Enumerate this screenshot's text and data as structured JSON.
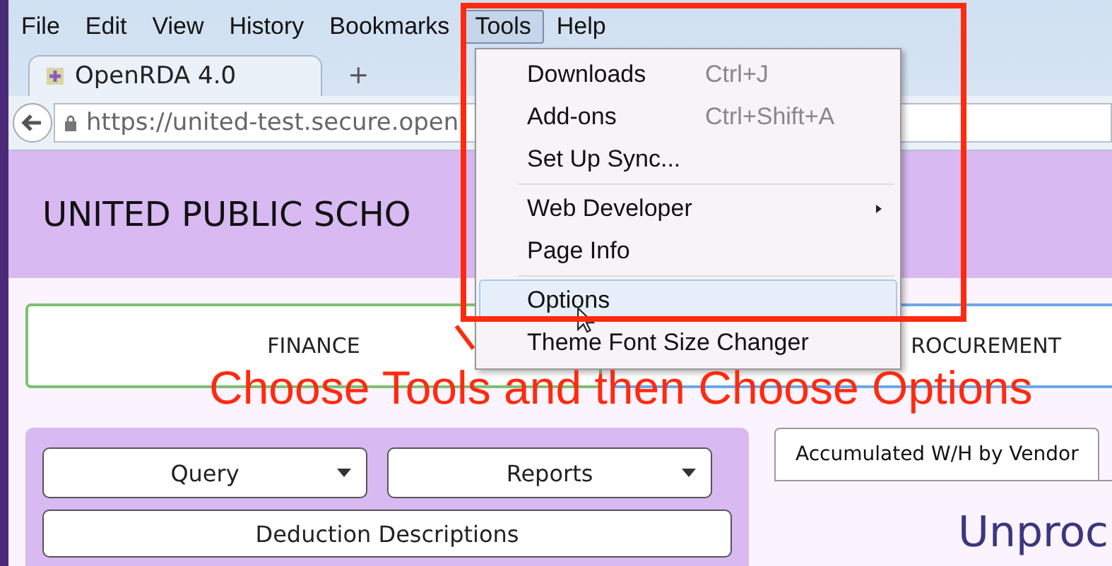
{
  "menu_bar": [
    {
      "label": "File",
      "selected": false
    },
    {
      "label": "Edit",
      "selected": false
    },
    {
      "label": "View",
      "selected": false
    },
    {
      "label": "History",
      "selected": false
    },
    {
      "label": "Bookmarks",
      "selected": false
    },
    {
      "label": "Tools",
      "selected": true
    },
    {
      "label": "Help",
      "selected": false
    }
  ],
  "tabs": [
    {
      "label": "OpenRDA 4.0",
      "selected": true
    }
  ],
  "new_tab": "+",
  "address_bar": {
    "value": "https://united-test.secure.open"
  },
  "header": {
    "title": "UNITED PUBLIC SCHO"
  },
  "modules": [
    {
      "label": "FINANCE",
      "color": "#7cc073"
    },
    {
      "label": "ROCUREMENT",
      "color": "#6aa9e6"
    }
  ],
  "panel_buttons": [
    {
      "label": "Query",
      "kind": "dropdown"
    },
    {
      "label": "Reports",
      "kind": "dropdown"
    },
    {
      "label": "Deduction Descriptions",
      "kind": "plain"
    }
  ],
  "content_tabs": [
    {
      "label": "Accumulated W/H by Vendor",
      "selected": true
    }
  ],
  "content_heading": "Unproc",
  "tools_menu": [
    {
      "kind": "item",
      "label": "Downloads",
      "shortcut": "Ctrl+J",
      "has_submenu": false,
      "selected": false
    },
    {
      "kind": "item",
      "label": "Add-ons",
      "shortcut": "Ctrl+Shift+A",
      "has_submenu": false,
      "selected": false
    },
    {
      "kind": "item",
      "label": "Set Up Sync...",
      "has_submenu": false,
      "selected": false
    },
    {
      "kind": "separator"
    },
    {
      "kind": "item",
      "label": "Web Developer",
      "has_submenu": true,
      "selected": false
    },
    {
      "kind": "item",
      "label": "Page Info",
      "has_submenu": false,
      "selected": false
    },
    {
      "kind": "separator"
    },
    {
      "kind": "item",
      "label": "Options",
      "has_submenu": false,
      "selected": true
    },
    {
      "kind": "item",
      "label": "Theme Font Size Changer",
      "has_submenu": false,
      "selected": false
    }
  ],
  "annotation": {
    "text": "Choose Tools and then Choose Options"
  }
}
